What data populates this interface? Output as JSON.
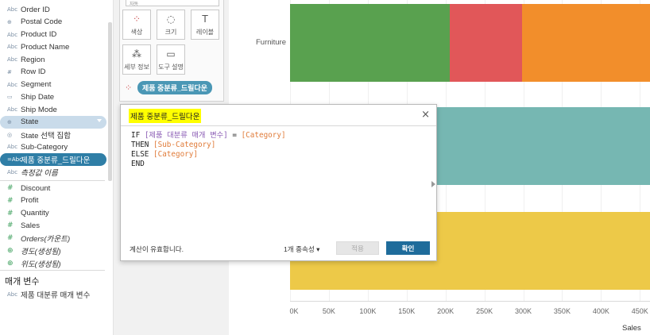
{
  "data_pane": {
    "fields": [
      {
        "icon": "Abc",
        "label": "Order ID"
      },
      {
        "icon": "⊕",
        "label": "Postal Code"
      },
      {
        "icon": "Abc",
        "label": "Product ID"
      },
      {
        "icon": "Abc",
        "label": "Product Name"
      },
      {
        "icon": "Abc",
        "label": "Region"
      },
      {
        "icon": "#",
        "label": "Row ID"
      },
      {
        "icon": "Abc",
        "label": "Segment"
      },
      {
        "icon": "▭",
        "label": "Ship Date"
      },
      {
        "icon": "Abc",
        "label": "Ship Mode"
      },
      {
        "icon": "⊕",
        "label": "State"
      },
      {
        "icon": "◎",
        "label": "State 선택 집합"
      },
      {
        "icon": "Abc",
        "label": "Sub-Category"
      },
      {
        "icon": "=Abc",
        "label": "제품 중분류_드릴다운"
      },
      {
        "icon": "Abc",
        "label": "측정값 이름"
      }
    ],
    "measures": [
      {
        "icon": "#",
        "label": "Discount"
      },
      {
        "icon": "#",
        "label": "Profit"
      },
      {
        "icon": "#",
        "label": "Quantity"
      },
      {
        "icon": "#",
        "label": "Sales"
      },
      {
        "icon": "#",
        "label": "Orders(카운트)"
      },
      {
        "icon": "⊕",
        "label": "경도(생성됨)"
      },
      {
        "icon": "⊕",
        "label": "위도(생성됨)"
      }
    ],
    "param_header": "매개 변수",
    "parameters": [
      {
        "icon": "Abc",
        "label": "제품 대분류 매개 변수"
      }
    ]
  },
  "marks": {
    "mark_type": "자동",
    "buttons": [
      {
        "icon": "⁘",
        "label": "색상"
      },
      {
        "icon": "◌",
        "label": "크기"
      },
      {
        "icon": "T",
        "label": "레이블"
      },
      {
        "icon": "⁂",
        "label": "세부 정보"
      },
      {
        "icon": "▭",
        "label": "도구 설명"
      }
    ],
    "color_pill": "제품 중분류_드릴다운"
  },
  "calc_dialog": {
    "title": "제품 중분류_드릴다운",
    "close_icon": "×",
    "code": {
      "if": "IF",
      "param": "[제품 대분류 매개 변수]",
      "eq": " = ",
      "category": "[Category]",
      "then": "THEN",
      "subcat": "[Sub-Category]",
      "else": "ELSE",
      "category2": "[Category]",
      "end": "END"
    },
    "status": "계산이 유효합니다.",
    "dependencies": "1개 종속성 ▾",
    "apply_label": "적용",
    "ok_label": "확인"
  },
  "chart_data": {
    "type": "bar",
    "orientation": "horizontal",
    "stacked": true,
    "categories": [
      "Furniture",
      "",
      ""
    ],
    "category_labels_visible": [
      "Furniture"
    ],
    "series": [
      {
        "color": "#59a14f",
        "values": [
          205000,
          0,
          0
        ]
      },
      {
        "color": "#e15759",
        "values": [
          93000,
          0,
          0
        ]
      },
      {
        "color": "#f28e2b",
        "values": [
          165000,
          0,
          0
        ]
      },
      {
        "color": "#76b7b2",
        "values": [
          0,
          463000,
          0
        ]
      },
      {
        "color": "#edc948",
        "values": [
          0,
          0,
          463000
        ]
      }
    ],
    "xlabel": "Sales",
    "xlim": [
      0,
      463000
    ],
    "xticks": [
      "0K",
      "50K",
      "100K",
      "150K",
      "200K",
      "250K",
      "300K",
      "350K",
      "400K",
      "450K"
    ],
    "xtick_values": [
      0,
      50000,
      100000,
      150000,
      200000,
      250000,
      300000,
      350000,
      400000,
      450000
    ],
    "grid": true
  }
}
